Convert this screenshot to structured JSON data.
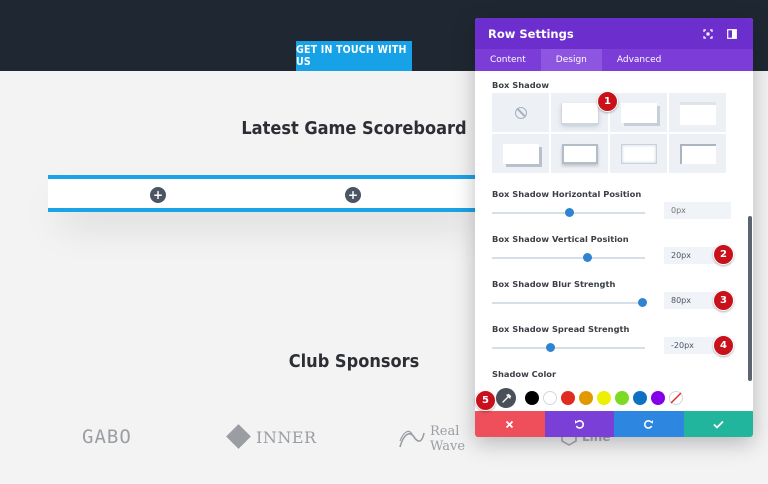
{
  "page": {
    "cta_button": "GET IN TOUCH WITH US",
    "scoreboard_title": "Latest Game Scoreboard",
    "sponsors_title": "Club Sponsors",
    "add_button_glyph": "+",
    "sponsors": [
      {
        "name": "GABO"
      },
      {
        "name": "INNER"
      },
      {
        "name_line1": "Real",
        "name_line2": "Wave"
      },
      {
        "name": "Line"
      }
    ]
  },
  "panel": {
    "title": "Row Settings",
    "header_icons": [
      "expand-icon",
      "sidebar-toggle-icon"
    ],
    "tabs": [
      {
        "label": "Content",
        "active": false
      },
      {
        "label": "Design",
        "active": true
      },
      {
        "label": "Advanced",
        "active": false
      }
    ],
    "box_shadow_label": "Box Shadow",
    "presets": [
      "none",
      "soft-bottom-right",
      "bottom-right",
      "top-left",
      "bottom-left-inset",
      "outline",
      "inset",
      "corner-inset"
    ],
    "selected_preset": 1,
    "fields": [
      {
        "label": "Box Shadow Horizontal Position",
        "value": "",
        "placeholder": "0px",
        "level": 0.5
      },
      {
        "label": "Box Shadow Vertical Position",
        "value": "20px",
        "placeholder": "",
        "level": 0.62
      },
      {
        "label": "Box Shadow Blur Strength",
        "value": "80px",
        "placeholder": "",
        "level": 0.98
      },
      {
        "label": "Box Shadow Spread Strength",
        "value": "-20px",
        "placeholder": "",
        "level": 0.38
      }
    ],
    "shadow_color_label": "Shadow Color",
    "swatch_colors": [
      "#000000",
      "#ffffff",
      "#e02b20",
      "#e09900",
      "#edf000",
      "#7cda24",
      "#0c71c3",
      "#8300e9"
    ],
    "badges": [
      "1",
      "2",
      "3",
      "4",
      "5"
    ],
    "action_buttons": [
      "cancel",
      "undo",
      "redo",
      "save"
    ]
  },
  "colors": {
    "accent_purple": "#6c2fce",
    "header_dark": "#1f2832",
    "cta_blue": "#17a1e6",
    "badge_red": "#c8111b"
  }
}
